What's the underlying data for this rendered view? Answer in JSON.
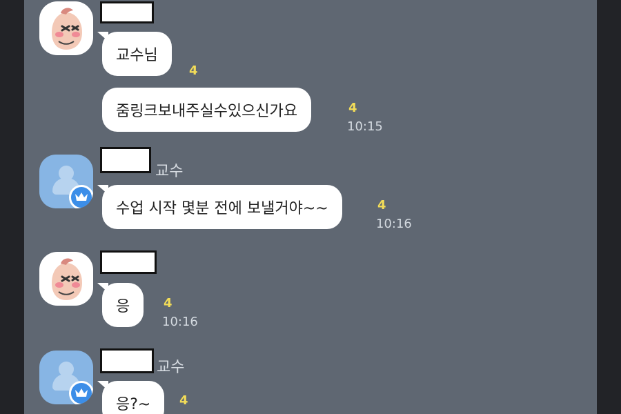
{
  "messages": [
    {
      "text": "교수님",
      "unread": "4"
    },
    {
      "text": "줌링크보내주실수있으신가요",
      "unread": "4",
      "time": "10:15"
    },
    {
      "sender": "교수",
      "text": "수업 시작 몇분 전에 보낼거야~~",
      "unread": "4",
      "time": "10:16"
    },
    {
      "text": "응",
      "unread": "4",
      "time": "10:16"
    },
    {
      "sender": "교수",
      "text": "응?~",
      "unread": "4"
    }
  ],
  "colors": {
    "chat_bg": "#5f6772",
    "bubble_bg": "#ffffff",
    "unread": "#f2dc58",
    "profile_badge": "#3c8ee8"
  },
  "icons": [
    "peach-avatar-icon",
    "default-profile-icon",
    "crown-badge-icon"
  ]
}
